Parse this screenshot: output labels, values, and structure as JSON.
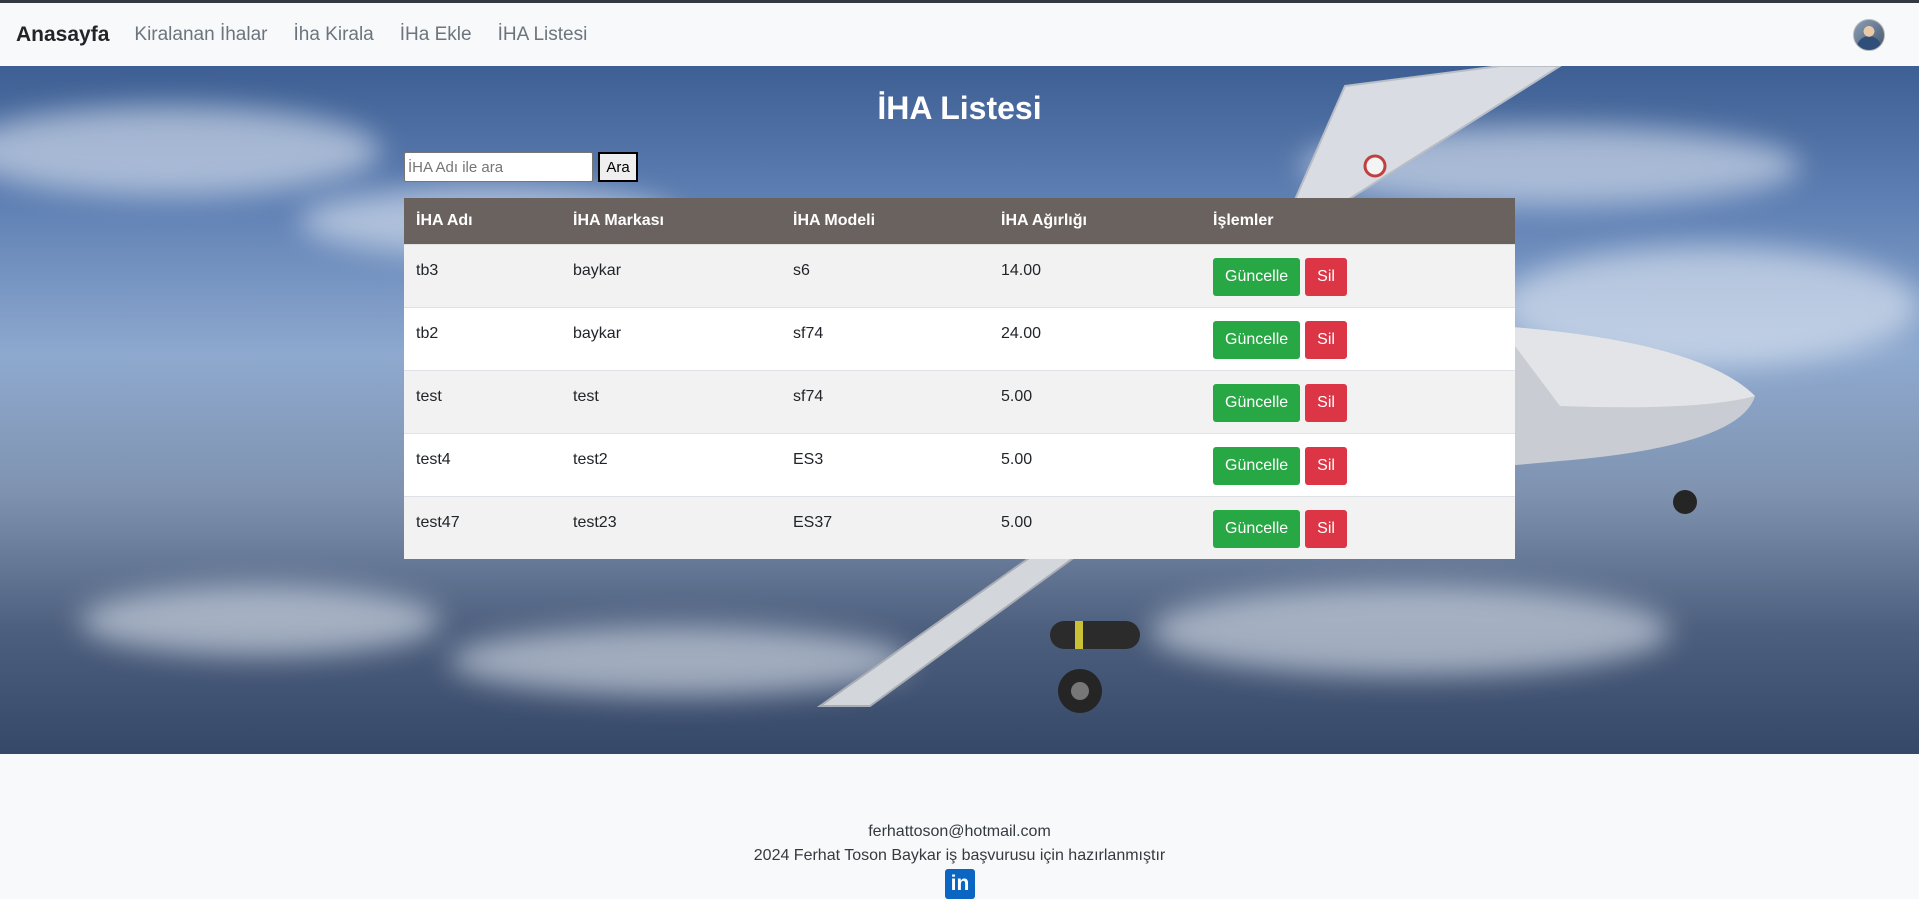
{
  "navbar": {
    "brand": "Anasayfa",
    "links": [
      "Kiralanan İhalar",
      "İha Kirala",
      "İHa Ekle",
      "İHA Listesi"
    ],
    "avatar_icon": "user-avatar"
  },
  "main": {
    "title": "İHA Listesi",
    "search": {
      "placeholder": "İHA Adı ile ara",
      "value": "",
      "button_label": "Ara"
    },
    "table": {
      "headers": [
        "İHA Adı",
        "İHA Markası",
        "İHA Modeli",
        "İHA Ağırlığı",
        "İşlemler"
      ],
      "rows": [
        {
          "name": "tb3",
          "brand": "baykar",
          "model": "s6",
          "weight": "14.00"
        },
        {
          "name": "tb2",
          "brand": "baykar",
          "model": "sf74",
          "weight": "24.00"
        },
        {
          "name": "test",
          "brand": "test",
          "model": "sf74",
          "weight": "5.00"
        },
        {
          "name": "test4",
          "brand": "test2",
          "model": "ES3",
          "weight": "5.00"
        },
        {
          "name": "test47",
          "brand": "test23",
          "model": "ES37",
          "weight": "5.00"
        }
      ],
      "update_label": "Güncelle",
      "delete_label": "Sil"
    }
  },
  "footer": {
    "email": "ferhattoson@hotmail.com",
    "note": "2024 Ferhat Toson Baykar iş başvurusu için hazırlanmıştır",
    "linkedin_icon": "linkedin-icon",
    "linkedin_text": "in"
  },
  "colors": {
    "navbar_bg": "#f8f9fa",
    "table_header_bg": "#6a625f",
    "update_button": "#28a745",
    "delete_button": "#dc3545",
    "linkedin": "#0a66c2"
  }
}
